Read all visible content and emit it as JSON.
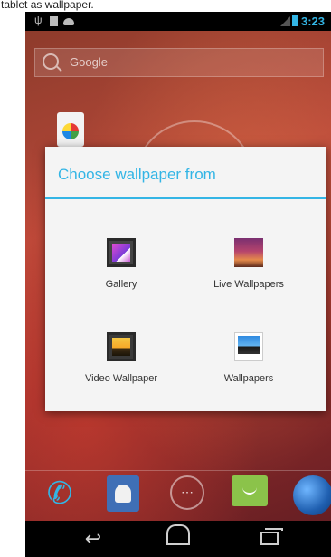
{
  "caption": "tablet as wallpaper.",
  "status_bar": {
    "time": "3:23",
    "accent_color": "#33b5e5",
    "icons": [
      "usb-icon",
      "sd-card-icon",
      "android-icon",
      "signal-icon",
      "battery-icon"
    ]
  },
  "search": {
    "label": "Google",
    "icon": "search-icon"
  },
  "dialog": {
    "title": "Choose wallpaper from",
    "accent_color": "#33b5e5",
    "options": [
      {
        "label": "Gallery",
        "icon": "gallery-icon"
      },
      {
        "label": "Live Wallpapers",
        "icon": "live-wallpapers-icon"
      },
      {
        "label": "Video Wallpaper",
        "icon": "video-wallpaper-icon"
      },
      {
        "label": "Wallpapers",
        "icon": "wallpapers-icon"
      }
    ]
  },
  "dock": {
    "items": [
      "phone-icon",
      "contacts-icon",
      "all-apps-icon",
      "messaging-icon",
      "browser-icon"
    ]
  },
  "navigation": {
    "buttons": [
      "back-icon",
      "home-icon",
      "recent-apps-icon"
    ]
  }
}
